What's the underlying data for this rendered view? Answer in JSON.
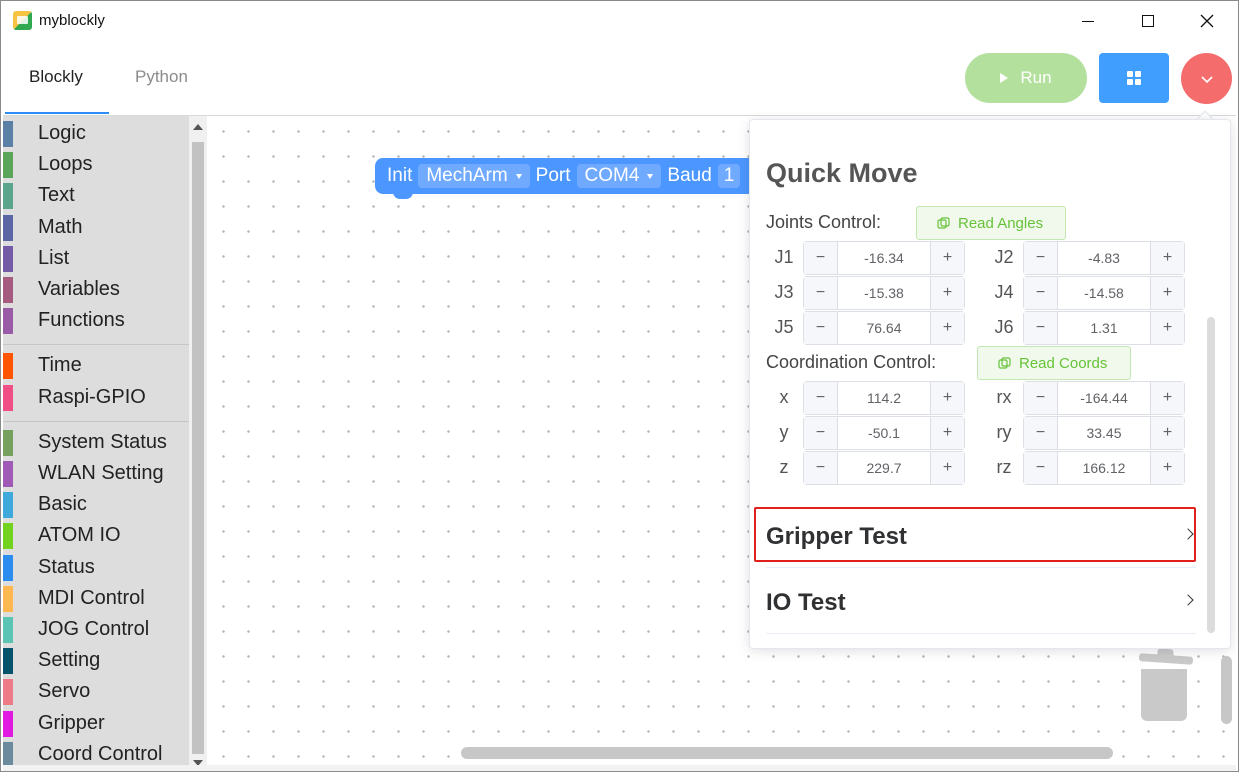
{
  "window": {
    "title": "myblockly"
  },
  "tabs": [
    {
      "label": "Blockly",
      "active": true
    },
    {
      "label": "Python",
      "active": false
    }
  ],
  "toolbar": {
    "run_label": "Run",
    "grid_icon": "grid-icon",
    "menu_icon": "chevron-down-icon"
  },
  "colors": {
    "accent": "#409eff",
    "run": "#b3e19d",
    "danger": "#f56c6c",
    "block": "#4c97ff",
    "success": "#67c23a"
  },
  "toolbox": {
    "groups": [
      [
        {
          "label": "Logic",
          "color": "#5b80a5"
        },
        {
          "label": "Loops",
          "color": "#5ba55b"
        },
        {
          "label": "Text",
          "color": "#5ba58c"
        },
        {
          "label": "Math",
          "color": "#5b67a5"
        },
        {
          "label": "List",
          "color": "#745ba5"
        },
        {
          "label": "Variables",
          "color": "#a55b80"
        },
        {
          "label": "Functions",
          "color": "#995ba5"
        }
      ],
      [
        {
          "label": "Time",
          "color": "#ff5500"
        },
        {
          "label": "Raspi-GPIO",
          "color": "#ef4f84"
        }
      ],
      [
        {
          "label": "System Status",
          "color": "#76a05d"
        },
        {
          "label": "WLAN Setting",
          "color": "#9f5ab5"
        },
        {
          "label": "Basic",
          "color": "#3fa9dc"
        },
        {
          "label": "ATOM IO",
          "color": "#72d21f"
        },
        {
          "label": "Status",
          "color": "#2d8cf0"
        },
        {
          "label": "MDI Control",
          "color": "#ffb84f"
        },
        {
          "label": "JOG Control",
          "color": "#5cc4b4"
        },
        {
          "label": "Setting",
          "color": "#05536b"
        },
        {
          "label": "Servo",
          "color": "#ee7c88"
        },
        {
          "label": "Gripper",
          "color": "#e01ae0"
        },
        {
          "label": "Coord Control",
          "color": "#6b8a9d"
        }
      ]
    ]
  },
  "block": {
    "init": "Init",
    "robot": "MechArm",
    "port_label": "Port",
    "port": "COM4",
    "baud_label": "Baud",
    "baud_partial": "1"
  },
  "quick_move": {
    "title": "Quick Move",
    "joints_label": "Joints Control:",
    "read_angles": "Read Angles",
    "joints": [
      {
        "name": "J1",
        "value": "-16.34"
      },
      {
        "name": "J2",
        "value": "-4.83"
      },
      {
        "name": "J3",
        "value": "-15.38"
      },
      {
        "name": "J4",
        "value": "-14.58"
      },
      {
        "name": "J5",
        "value": "76.64"
      },
      {
        "name": "J6",
        "value": "1.31"
      }
    ],
    "coords_label": "Coordination Control:",
    "read_coords": "Read Coords",
    "coords": [
      {
        "name": "x",
        "value": "114.2"
      },
      {
        "name": "rx",
        "value": "-164.44"
      },
      {
        "name": "y",
        "value": "-50.1"
      },
      {
        "name": "ry",
        "value": "33.45"
      },
      {
        "name": "z",
        "value": "229.7"
      },
      {
        "name": "rz",
        "value": "166.12"
      }
    ],
    "minus": "−",
    "plus": "+",
    "sections": [
      {
        "label": "Gripper Test"
      },
      {
        "label": "IO Test"
      }
    ]
  }
}
